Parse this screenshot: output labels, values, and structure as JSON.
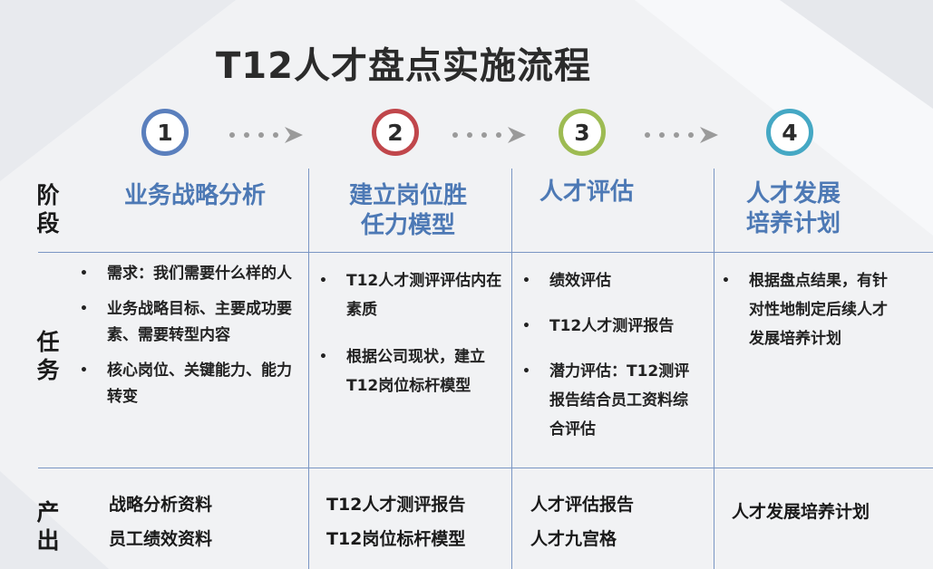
{
  "title": "T12人才盘点实施流程",
  "steps": [
    {
      "number": "1",
      "color": "#5a7fbd"
    },
    {
      "number": "2",
      "color": "#c0464b"
    },
    {
      "number": "3",
      "color": "#9dbb52"
    },
    {
      "number": "4",
      "color": "#45a8c4"
    }
  ],
  "row_labels": {
    "stage": "阶段",
    "task": "任务",
    "output": "产出"
  },
  "stages": [
    {
      "title_lines": [
        "业务战略分析"
      ]
    },
    {
      "title_lines": [
        "建立岗位胜",
        "任力模型"
      ]
    },
    {
      "title_lines": [
        "人才评估"
      ]
    },
    {
      "title_lines": [
        "人才发展",
        "培养计划"
      ]
    }
  ],
  "tasks": [
    {
      "items": [
        {
          "bullet": "•",
          "text": "需求：我们需要什么样的人"
        },
        {
          "bullet": "•",
          "text": "业务战略目标、主要成功要素、需要转型内容"
        },
        {
          "bullet": "•",
          "text": "核心岗位、关键能力、能力转变"
        }
      ]
    },
    {
      "items": [
        {
          "bullet": "•",
          "text": "T12人才测评评估内在素质"
        },
        {
          "bullet": "•",
          "text": "根据公司现状，建立T12岗位标杆模型"
        }
      ]
    },
    {
      "items": [
        {
          "bullet": "•",
          "text": "绩效评估"
        },
        {
          "bullet": "•",
          "text": "T12人才测评报告"
        },
        {
          "bullet": "•",
          "text": "潜力评估：T12测评报告结合员工资料综合评估"
        }
      ]
    },
    {
      "items": [
        {
          "bullet": "•",
          "text": "根据盘点结果，有针对性地制定后续人才发展培养计划"
        }
      ]
    }
  ],
  "outputs": [
    {
      "items": [
        "战略分析资料",
        "员工绩效资料"
      ]
    },
    {
      "items": [
        "T12人才测评报告",
        "T12岗位标杆模型"
      ]
    },
    {
      "items": [
        "人才评估报告",
        "人才九宫格"
      ]
    },
    {
      "items": [
        "人才发展培养计划"
      ]
    }
  ],
  "colors": {
    "stage_title": "#4d79b5",
    "divider": "#7a96c4",
    "arrow": "#9a9a9a"
  }
}
